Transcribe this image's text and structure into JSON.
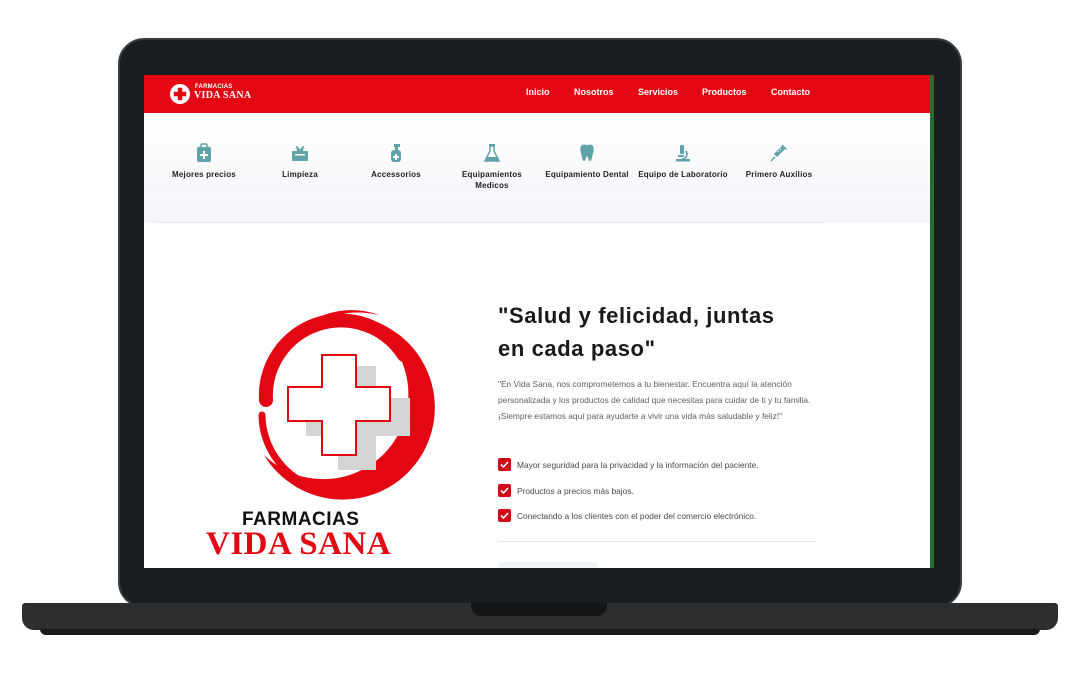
{
  "header": {
    "logo_top": "FARMACIAS",
    "logo_bottom": "VIDA SANA",
    "nav": [
      "Inicio",
      "Nosotros",
      "Servicios",
      "Productos",
      "Contacto"
    ]
  },
  "categories": [
    {
      "label": "Mejores precios",
      "icon": "medical-bag-icon"
    },
    {
      "label": "Limpieza",
      "icon": "tissue-box-icon"
    },
    {
      "label": "Accessorios",
      "icon": "spray-bottle-icon"
    },
    {
      "label": "Equipamientos Medicos",
      "icon": "flask-icon"
    },
    {
      "label": "Equipamiento Dental",
      "icon": "tooth-icon"
    },
    {
      "label": "Equipo de Laboratorio",
      "icon": "microscope-icon"
    },
    {
      "label": "Primero Auxilios",
      "icon": "syringe-icon"
    }
  ],
  "hero": {
    "brand_top": "FARMACIAS",
    "brand_bottom": "VIDA SANA",
    "title": "\"Salud y felicidad, juntas en cada paso\"",
    "text": "\"En Vida Sana, nos comprometemos a tu bienestar. Encuentra aquí la atención personalizada y los productos de calidad que necesitas para cuidar de ti y tu familia. ¡Siempre estamos aquí para ayudarte a vivir una vida más saludable y feliz!\"",
    "checks": [
      "Mayor seguridad para la privacidad y la información del paciente.",
      "Productos a precios más bajos.",
      "Conectando a los clientes con el poder del comercio electrónico."
    ]
  },
  "colors": {
    "brand_red": "#e30613",
    "icon_teal": "#5fa3a8",
    "frame": "#1b1e21"
  }
}
